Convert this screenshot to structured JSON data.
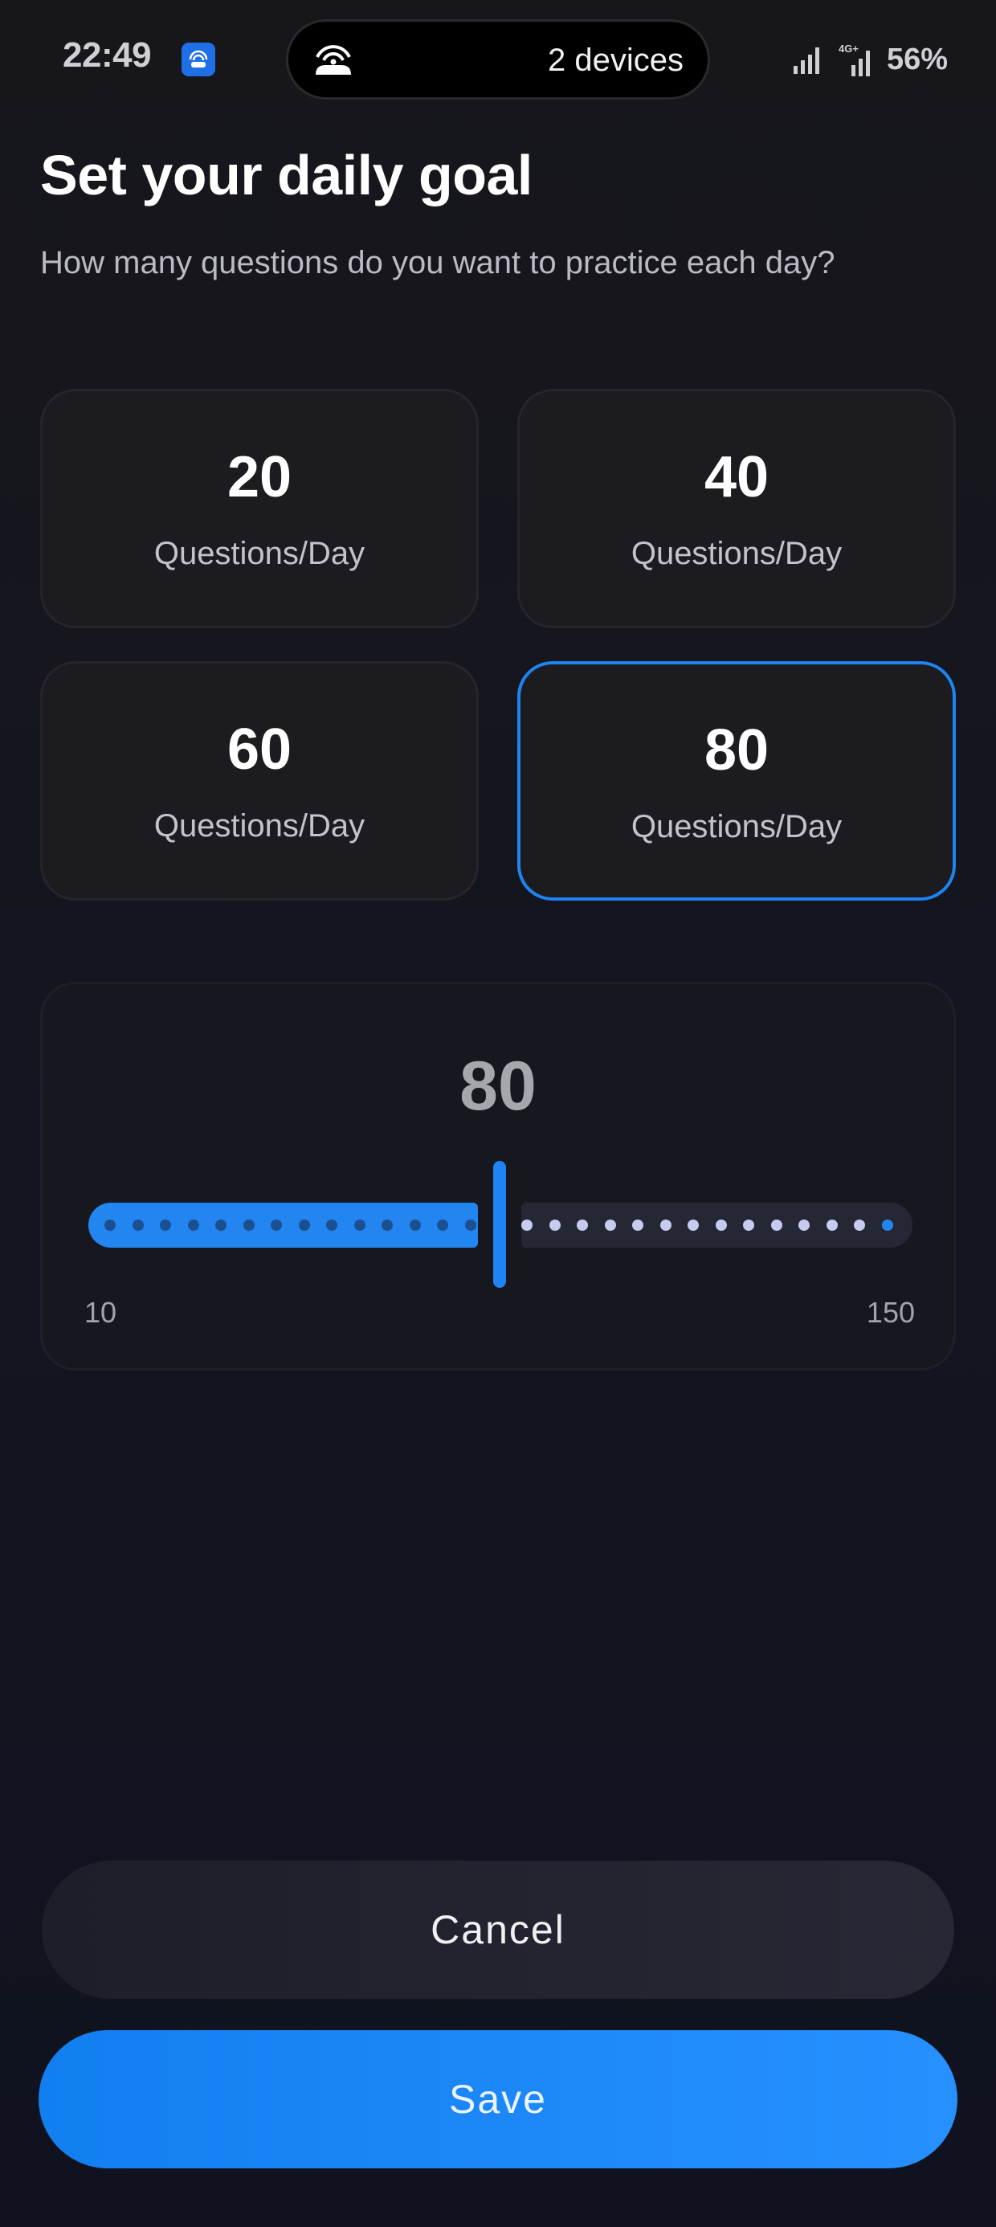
{
  "status_bar": {
    "time": "22:49",
    "island_text": "2 devices",
    "network": "4G+",
    "battery": "56%",
    "icons": [
      "hotspot-icon",
      "signal-icon",
      "mobile-signal-4g-icon"
    ]
  },
  "header": {
    "title": "Set your daily goal",
    "subtitle": "How many questions do you want to practice each day?"
  },
  "options": [
    {
      "value": "20",
      "label": "Questions/Day",
      "selected": false
    },
    {
      "value": "40",
      "label": "Questions/Day",
      "selected": false
    },
    {
      "value": "60",
      "label": "Questions/Day",
      "selected": false
    },
    {
      "value": "80",
      "label": "Questions/Day",
      "selected": true
    }
  ],
  "slider": {
    "value": "80",
    "min": "10",
    "max": "150"
  },
  "buttons": {
    "cancel": "Cancel",
    "save": "Save"
  },
  "colors": {
    "accent": "#1f83f1",
    "background": "#14151d",
    "card": "#1b1b20"
  }
}
